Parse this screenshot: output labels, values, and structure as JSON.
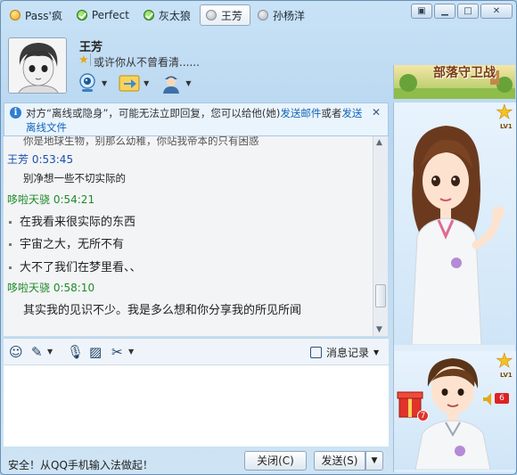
{
  "tabs": [
    {
      "label": "Pass'疯",
      "status": "qq"
    },
    {
      "label": "Perfect",
      "status": "online"
    },
    {
      "label": "灰太狼",
      "status": "online"
    },
    {
      "label": "王芳",
      "status": "offline",
      "active": true
    },
    {
      "label": "孙杨洋",
      "status": "offline"
    }
  ],
  "contact": {
    "name": "王芳",
    "signature": "或许你从不曾看清......"
  },
  "notice": {
    "text_before": "对方“离线或隐身”，可能无法立即回复，您可以给他(她)",
    "link1": "发送邮件",
    "middle": "或者",
    "link2": "发送离线文件"
  },
  "messages": {
    "cut_line": "你是地球生物，别那么幼稚，你站我帝本的只有困惑",
    "m1_header": "王芳  0:53:45",
    "m1_body": "别净想一些不切实际的",
    "m2_header": "哆啦天骁  0:54:21",
    "m2_lines": [
      "在我看来很实际的东西",
      "宇宙之大，无所不有",
      "大不了我们在梦里看、、"
    ],
    "m3_header": "哆啦天骁  0:58:10",
    "m3_body": "其实我的见识不少。我是多么想和你分享我的所见所闻"
  },
  "input_toolbar": {
    "history_label": "消息记录"
  },
  "footer": {
    "tip": "安全！从QQ手机输入法做起！",
    "close_label": "关闭(C)",
    "send_label": "发送(S)"
  },
  "ad": {
    "text": "部落守卫战"
  },
  "level_badge": "LV1",
  "gift_count": "7",
  "volume_badge": "6",
  "colors": {
    "accent": "#1366b8",
    "self_name": "#1e8a2a",
    "peer_name": "#1a4fb0"
  }
}
